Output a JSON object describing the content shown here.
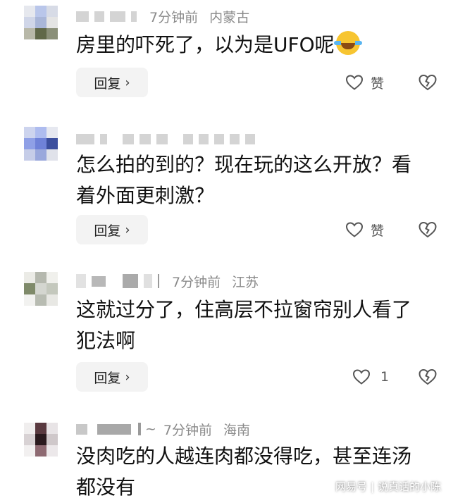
{
  "comments": [
    {
      "time": "7分钟前",
      "location": "内蒙古",
      "lines": [
        "房里的吓死了，以为是UFO呢"
      ],
      "emoji": "laughing-crying-emoji",
      "reply_label": "回复",
      "like_label": "赞"
    },
    {
      "lines": [
        "怎么拍的到的？现在玩的这么开放？看",
        "着外面更刺激？"
      ],
      "reply_label": "回复",
      "like_label": "赞"
    },
    {
      "time": "7分钟前",
      "location": "江苏",
      "lines": [
        "这就过分了，住高层不拉窗帘别人看了",
        "犯法啊"
      ],
      "reply_label": "回复",
      "like_count": "1"
    },
    {
      "time": "7分钟前",
      "location": "海南",
      "meta_symbol": "~",
      "lines": [
        "没肉吃的人越连肉都没得吃，甚至连汤",
        "都没有"
      ]
    }
  ],
  "watermark": {
    "source": "网易号",
    "divider": "|",
    "author": "说真话的小陈"
  },
  "colors": {
    "meta_text": "#8a8a8a",
    "reply_bg": "#f3f3f3"
  }
}
